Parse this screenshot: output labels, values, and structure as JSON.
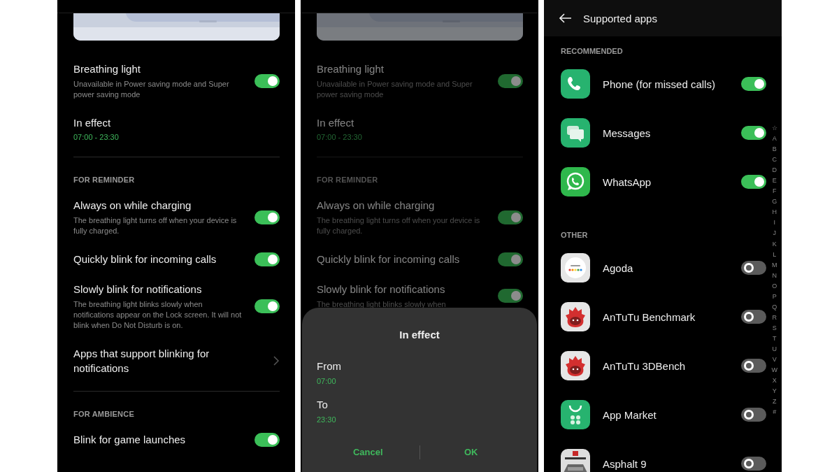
{
  "screens": [
    {
      "kind": "settings",
      "dimmed": false,
      "sections": [
        {
          "items": [
            {
              "kind": "toggle",
              "title": "Breathing light",
              "subtitle": "Unavailable in Power saving mode and Super power saving mode",
              "on": true
            },
            {
              "kind": "time",
              "title": "In effect",
              "value": "07:00  - 23:30"
            }
          ]
        },
        {
          "header": "FOR REMINDER",
          "items": [
            {
              "kind": "toggle",
              "title": "Always on while charging",
              "subtitle": "The breathing light turns off when your device is fully charged.",
              "on": true
            },
            {
              "kind": "toggle",
              "title": "Quickly blink for incoming calls",
              "on": true
            },
            {
              "kind": "toggle",
              "title": "Slowly blink for notifications",
              "subtitle": "The breathing light blinks slowly when notifications appear on the Lock screen. It will not blink when Do Not Disturb is on.",
              "on": true
            },
            {
              "kind": "link",
              "title": "Apps that support blinking for notifications"
            }
          ]
        },
        {
          "header": "FOR AMBIENCE",
          "items": [
            {
              "kind": "toggle",
              "title": "Blink for game launches",
              "on": true
            }
          ]
        }
      ]
    },
    {
      "kind": "settings",
      "dimmed": true,
      "sections": [
        {
          "items": [
            {
              "kind": "toggle",
              "title": "Breathing light",
              "subtitle": "Unavailable in Power saving mode and Super power saving mode",
              "on": true
            },
            {
              "kind": "time",
              "title": "In effect",
              "value": "07:00  - 23:30"
            }
          ]
        },
        {
          "header": "FOR REMINDER",
          "items": [
            {
              "kind": "toggle",
              "title": "Always on while charging",
              "subtitle": "The breathing light turns off when your device is fully charged.",
              "on": true
            },
            {
              "kind": "toggle",
              "title": "Quickly blink for incoming calls",
              "on": true
            },
            {
              "kind": "toggle",
              "title": "Slowly blink for notifications",
              "subtitle": "The breathing light blinks slowly when",
              "on": true
            }
          ]
        }
      ],
      "dialog": {
        "title": "In effect",
        "fields": [
          {
            "label": "From",
            "value": "07:00"
          },
          {
            "label": "To",
            "value": "23:30"
          }
        ],
        "buttons": [
          "Cancel",
          "OK"
        ]
      }
    },
    {
      "kind": "apps",
      "title": "Supported apps",
      "groups": [
        {
          "header": "RECOMMENDED",
          "apps": [
            {
              "name": "Phone (for missed calls)",
              "on": true
            },
            {
              "name": "Messages",
              "on": true
            },
            {
              "name": "WhatsApp",
              "on": true
            }
          ]
        },
        {
          "header": "OTHER",
          "apps": [
            {
              "name": "Agoda",
              "on": false
            },
            {
              "name": "AnTuTu Benchmark",
              "on": false
            },
            {
              "name": "AnTuTu 3DBench",
              "on": false
            },
            {
              "name": "App Market",
              "on": false
            },
            {
              "name": "Asphalt 9",
              "on": false
            }
          ]
        }
      ],
      "index": [
        "☆",
        "A",
        "B",
        "C",
        "D",
        "E",
        "F",
        "G",
        "H",
        "I",
        "J",
        "K",
        "L",
        "M",
        "N",
        "O",
        "P",
        "Q",
        "R",
        "S",
        "T",
        "U",
        "V",
        "W",
        "X",
        "Y",
        "Z",
        "#"
      ]
    }
  ]
}
